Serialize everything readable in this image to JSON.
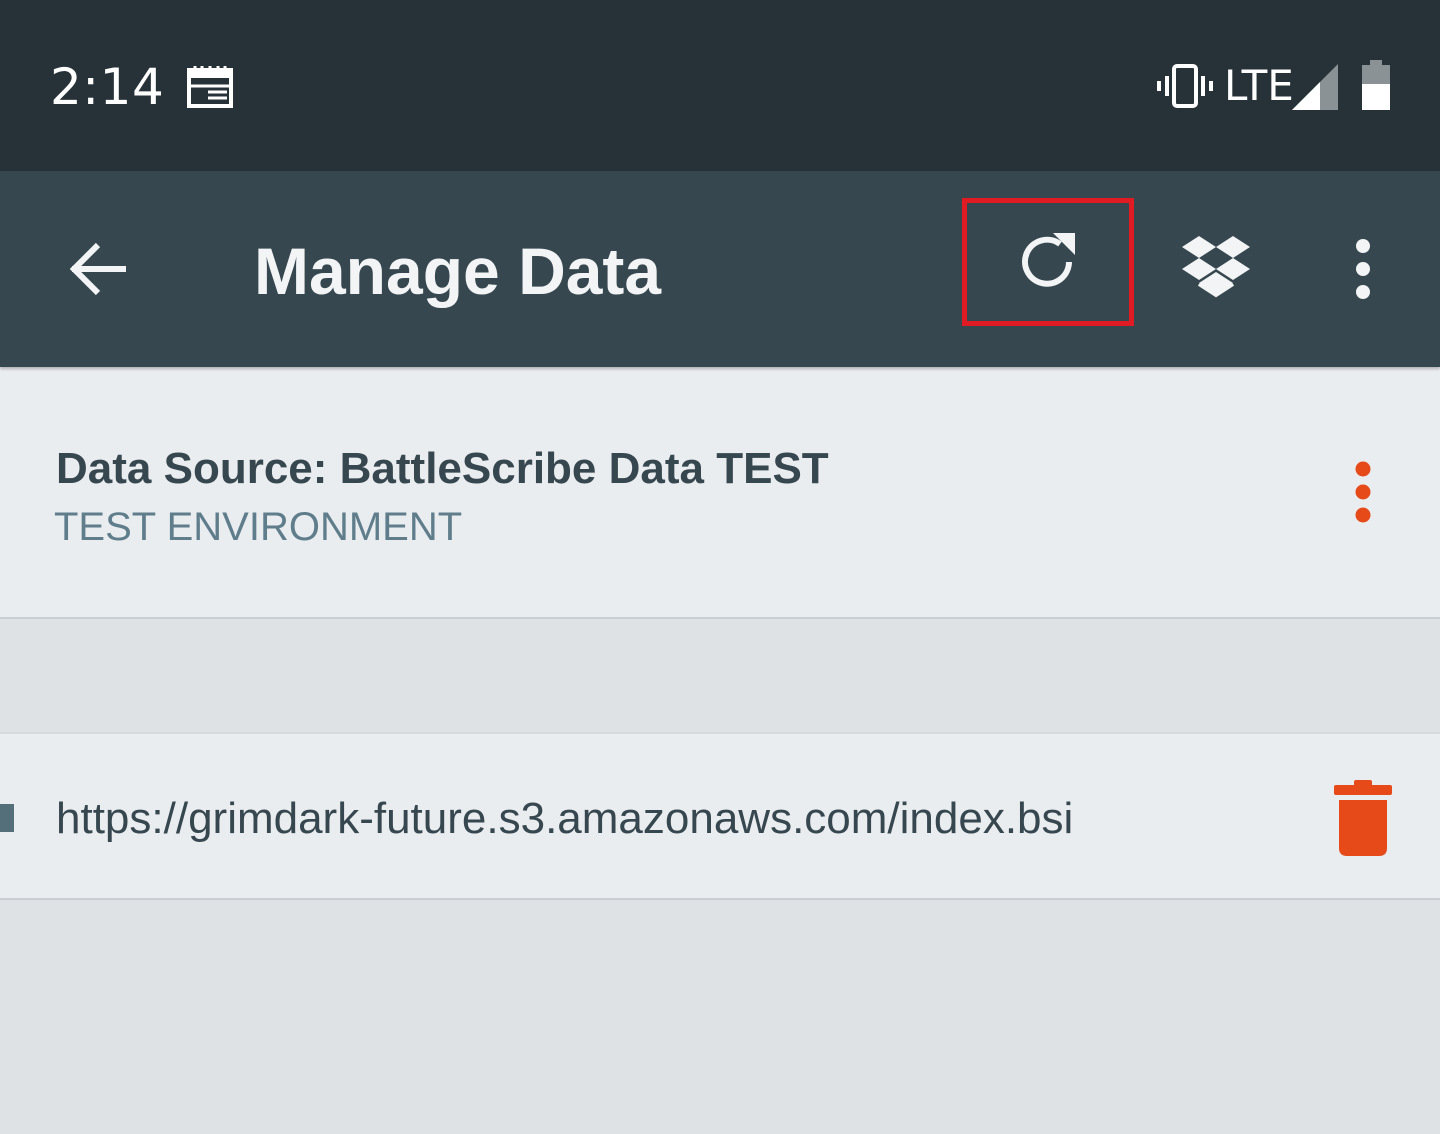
{
  "status_bar": {
    "time": "2:14",
    "network": "LTE",
    "icons": [
      "calendar-icon",
      "vibrate-icon",
      "signal-icon",
      "battery-icon"
    ]
  },
  "app_bar": {
    "title": "Manage Data",
    "actions": [
      "back-arrow-icon",
      "refresh-icon",
      "dropbox-icon",
      "more-vert-icon"
    ],
    "highlight_color": "#e01b24"
  },
  "data_source": {
    "title": "Data Source: BattleScribe Data TEST",
    "subtitle": "TEST ENVIRONMENT",
    "menu_icon": "more-vert-icon"
  },
  "sources": [
    {
      "url": "https://grimdark-future.s3.amazonaws.com/index.bsi",
      "action_icon": "delete-icon"
    }
  ],
  "colors": {
    "status_bar": "#263238",
    "app_bar": "#37474f",
    "accent": "#e64a19",
    "card": "#eaedf0",
    "background": "#dfe2e4"
  }
}
